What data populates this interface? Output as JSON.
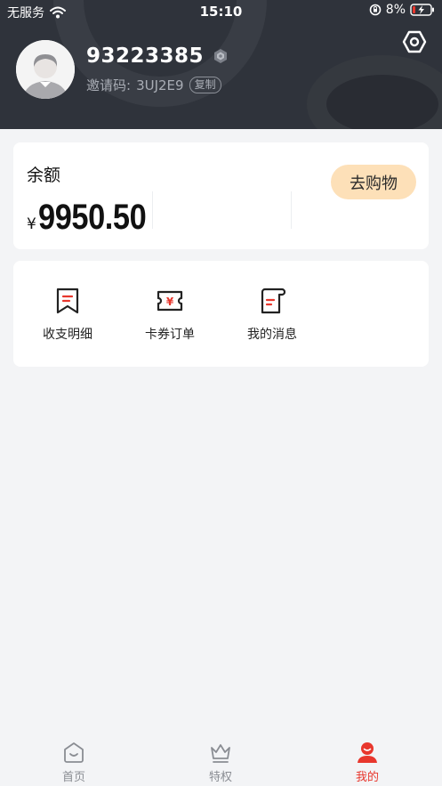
{
  "status_bar": {
    "carrier": "无服务",
    "time": "15:10",
    "battery": "8%"
  },
  "profile": {
    "user_id": "93223385",
    "invite_label": "邀请码:",
    "invite_code": "3UJ2E9",
    "copy_label": "复制"
  },
  "balance": {
    "label": "余额",
    "currency": "¥",
    "amount": "9950.50",
    "shop_button": "去购物"
  },
  "menu": {
    "items": [
      {
        "label": "收支明细",
        "icon": "bookmark-list-icon"
      },
      {
        "label": "卡券订单",
        "icon": "coupon-icon"
      },
      {
        "label": "我的消息",
        "icon": "message-doc-icon"
      }
    ]
  },
  "tabbar": {
    "items": [
      {
        "label": "首页",
        "icon": "home-icon",
        "active": false
      },
      {
        "label": "特权",
        "icon": "crown-icon",
        "active": false
      },
      {
        "label": "我的",
        "icon": "profile-icon",
        "active": true
      }
    ]
  },
  "colors": {
    "header_bg": "#2f333b",
    "accent_red": "#e8372d",
    "shop_button_bg": "#fde0b8",
    "page_bg": "#f3f4f6"
  }
}
